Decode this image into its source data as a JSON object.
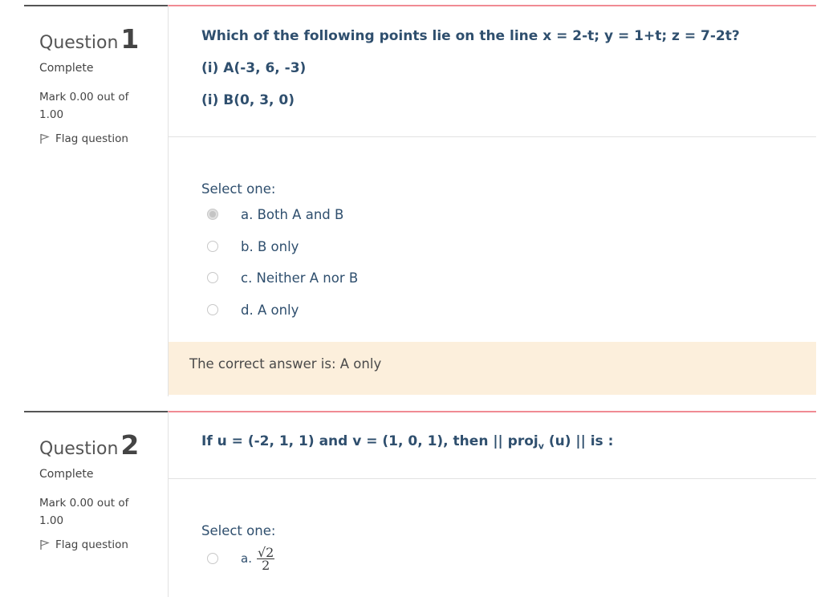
{
  "questions": [
    {
      "label": "Question",
      "number": "1",
      "state": "Complete",
      "grade": "Mark 0.00 out of 1.00",
      "flag": "Flag question",
      "text_lines": [
        "Which of the following points lie on the line x = 2-t; y = 1+t; z = 7-2t?",
        "(i) A(-3, 6, -3)",
        "(i) B(0, 3, 0)"
      ],
      "prompt": "Select one:",
      "options": [
        {
          "label": "a. Both A and B",
          "checked": true
        },
        {
          "label": "b. B only",
          "checked": false
        },
        {
          "label": "c. Neither A nor B",
          "checked": false
        },
        {
          "label": "d. A only",
          "checked": false
        }
      ],
      "feedback": "The correct answer is: A only"
    },
    {
      "label": "Question",
      "number": "2",
      "state": "Complete",
      "grade": "Mark 0.00 out of 1.00",
      "flag": "Flag question",
      "text_pre": "If u = (-2, 1, 1) and v = (1, 0, 1), then || proj",
      "text_sub": "v",
      "text_post": " (u) || is :",
      "prompt": "Select one:",
      "options": [
        {
          "prefix": "a.",
          "numerator": "√2",
          "denominator": "2",
          "checked": false
        }
      ]
    }
  ]
}
